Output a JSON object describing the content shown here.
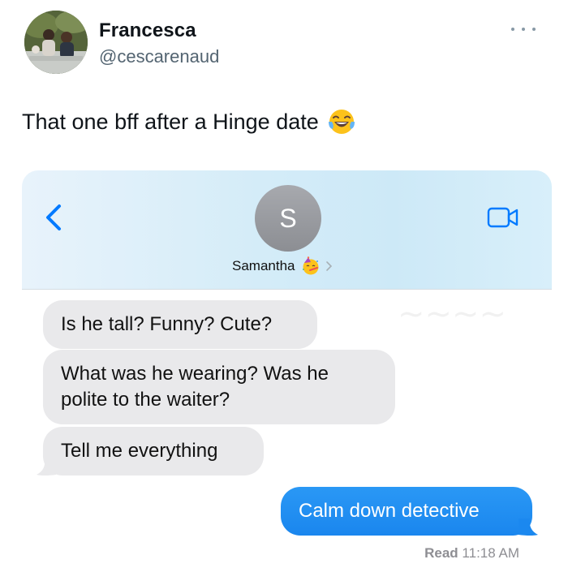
{
  "tweet": {
    "display_name": "Francesca",
    "handle": "@cescarenaud",
    "text": "That one bff after a Hinge date",
    "text_emoji": "laughing-tears-emoji"
  },
  "imessage": {
    "contact": {
      "initial": "S",
      "name": "Samantha",
      "name_emoji": "party-face-emoji"
    },
    "messages": [
      {
        "direction": "incoming",
        "text": "Is he tall? Funny? Cute?"
      },
      {
        "direction": "incoming",
        "text": "What was he wearing? Was he polite to the waiter?"
      },
      {
        "direction": "incoming",
        "text": "Tell me everything"
      },
      {
        "direction": "outgoing",
        "text": "Calm down detective"
      }
    ],
    "read_receipt": {
      "label": "Read",
      "time": "11:18 AM"
    },
    "colors": {
      "incoming_bubble": "#e9e9eb",
      "outgoing_bubble": "#1d8ff2",
      "accent": "#007aff"
    }
  }
}
